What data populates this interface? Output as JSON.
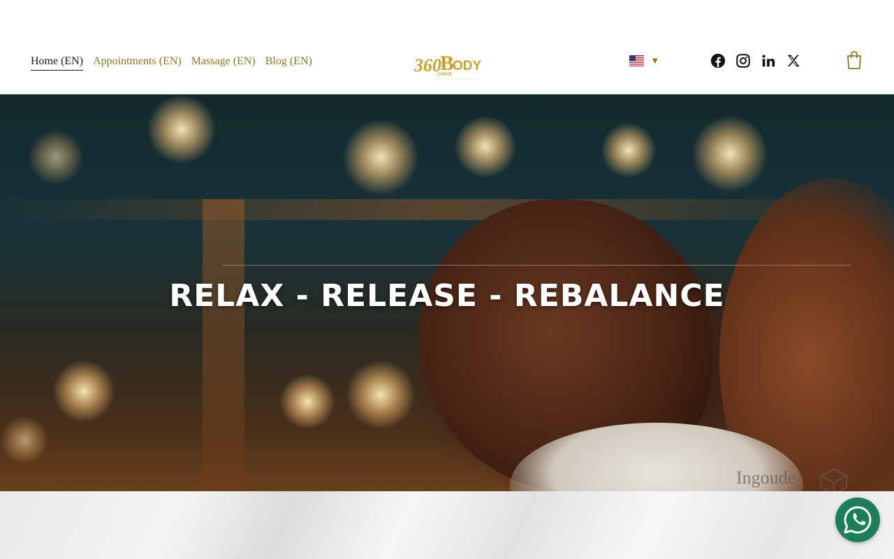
{
  "nav": {
    "items": [
      {
        "label": "Home (EN)",
        "active": true
      },
      {
        "label": "Appointments (EN)",
        "active": false
      },
      {
        "label": "Massage (EN)",
        "active": false
      },
      {
        "label": "Blog (EN)",
        "active": false
      }
    ]
  },
  "logo": {
    "brand": "360 BODY CURVE",
    "icon": "brand-logo"
  },
  "language": {
    "flag_icon": "us-flag-icon",
    "caret_icon": "caret-down-icon"
  },
  "social": {
    "icons": [
      "facebook-icon",
      "instagram-icon",
      "linkedin-icon",
      "x-icon"
    ]
  },
  "cart": {
    "icon": "shopping-bag-icon"
  },
  "hero": {
    "title": "RELAX - RELEASE - REBALANCE",
    "watermark": "Ingoude"
  },
  "whatsapp": {
    "icon": "whatsapp-icon"
  },
  "colors": {
    "accent": "#8a7a1e",
    "nav_active": "#1a1a1a",
    "whatsapp": "#1d7f55"
  }
}
